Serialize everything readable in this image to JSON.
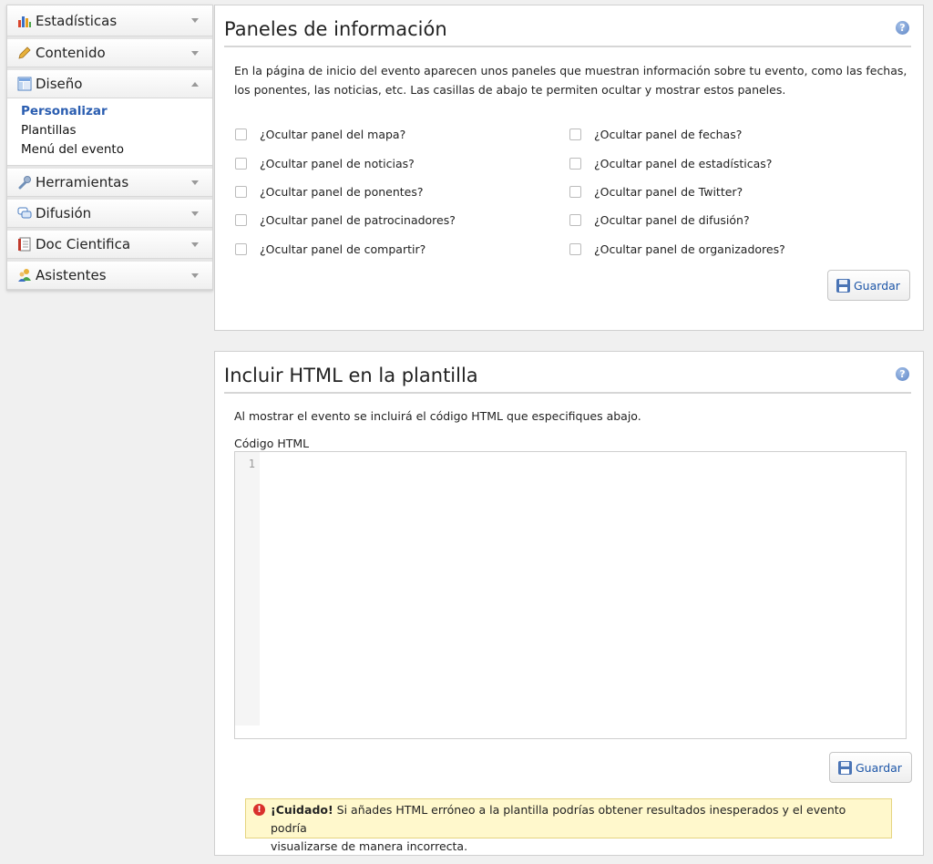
{
  "sidebar": {
    "sections": [
      {
        "label": "Estadísticas",
        "icon": "bar-chart-icon"
      },
      {
        "label": "Contenido",
        "icon": "pencil-icon"
      },
      {
        "label": "Diseño",
        "icon": "layout-icon",
        "items": [
          "Personalizar",
          "Plantillas",
          "Menú del evento"
        ],
        "active_item": "Personalizar"
      },
      {
        "label": "Herramientas",
        "icon": "wrench-icon"
      },
      {
        "label": "Difusión",
        "icon": "chat-bubbles-icon"
      },
      {
        "label": "Doc Cientifica",
        "icon": "document-icon"
      },
      {
        "label": "Asistentes",
        "icon": "users-icon"
      }
    ]
  },
  "panel1": {
    "title": "Paneles de información",
    "description_line1": "En la página de inicio del evento aparecen unos paneles que muestran información sobre tu evento, como las fechas,",
    "description_line2": "los ponentes, las noticias, etc. Las casillas de abajo te permiten ocultar y mostrar estos paneles.",
    "checkboxes_left": [
      "¿Ocultar panel del mapa?",
      "¿Ocultar panel de noticias?",
      "¿Ocultar panel de ponentes?",
      "¿Ocultar panel de patrocinadores?",
      "¿Ocultar panel de compartir?"
    ],
    "checkboxes_right": [
      "¿Ocultar panel de fechas?",
      "¿Ocultar panel de estadísticas?",
      "¿Ocultar panel de Twitter?",
      "¿Ocultar panel de difusión?",
      "¿Ocultar panel de organizadores?"
    ],
    "save_label": "Guardar"
  },
  "panel2": {
    "title": "Incluir HTML en la plantilla",
    "description": "Al mostrar el evento se incluirá el código HTML que especifiques abajo.",
    "code_label": "Código HTML",
    "line_number": "1",
    "save_label": "Guardar",
    "warning_bold": "¡Cuidado!",
    "warning_text_line1": " Si añades HTML erróneo a la plantilla podrías obtener resultados inesperados y el evento podría",
    "warning_text_line2": "visualizarse de manera incorrecta."
  },
  "colors": {
    "link_active": "#2a5db0",
    "button_text": "#1d56a8",
    "warning_bg": "#fff8cc",
    "warning_icon": "#d9302c"
  }
}
